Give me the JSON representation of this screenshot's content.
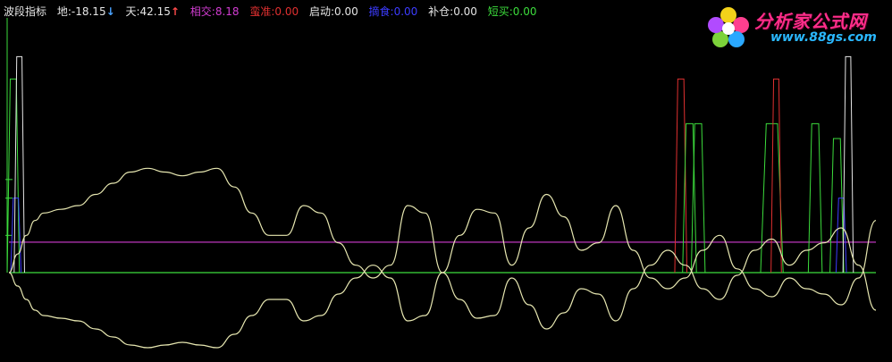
{
  "legend": {
    "indicator_name": "波段指标",
    "items": [
      {
        "label": "地:",
        "value": "-18.15",
        "color": "#e6e6e6",
        "marker": "↓"
      },
      {
        "label": "天:",
        "value": "42.15",
        "color": "#e6e6e6",
        "marker": "↑"
      },
      {
        "label": "相交:",
        "value": "8.18",
        "color": "#d23cd2"
      },
      {
        "label": "蛮准:",
        "value": "0.00",
        "color": "#e03030"
      },
      {
        "label": "启动:",
        "value": "0.00",
        "color": "#e6e6e6"
      },
      {
        "label": "摘食:",
        "value": "0.00",
        "color": "#3c3cff"
      },
      {
        "label": "补仓:",
        "value": "0.00",
        "color": "#e6e6e6"
      },
      {
        "label": "短买:",
        "value": "0.00",
        "color": "#3cdc3c"
      }
    ]
  },
  "logo": {
    "title": "分析家公式网",
    "url": "www.88gs.com"
  },
  "chart_data": {
    "type": "line",
    "ylim": [
      -30,
      60
    ],
    "xlim": [
      0,
      100
    ],
    "grid": false,
    "series": [
      {
        "color": "#e6e6b0",
        "x": [
          0,
          1,
          2,
          3,
          4,
          6,
          8,
          10,
          12,
          14,
          16,
          18,
          20,
          22,
          24,
          26,
          28,
          30,
          32,
          34,
          36,
          38,
          40,
          42,
          44,
          46,
          48,
          50,
          52,
          54,
          56,
          58,
          60,
          62,
          64,
          66,
          68,
          70,
          72,
          74,
          76,
          78,
          80,
          82,
          84,
          86,
          88,
          90,
          92,
          94,
          96,
          98,
          100
        ],
        "values": [
          0,
          5,
          10,
          14,
          16,
          17,
          18,
          21,
          24,
          27,
          28,
          27,
          26,
          27,
          28,
          23,
          16,
          10,
          10,
          18,
          16,
          8,
          2,
          -2,
          2,
          18,
          16,
          0,
          10,
          17,
          16,
          2,
          12,
          21,
          15,
          6,
          8,
          18,
          6,
          -2,
          -6,
          -2,
          6,
          10,
          1,
          -6,
          -9,
          -2,
          -6,
          -8,
          -12,
          -2,
          14
        ]
      },
      {
        "color": "#e6e6b0",
        "x": [
          0,
          1,
          2,
          3,
          4,
          6,
          8,
          10,
          12,
          14,
          16,
          18,
          20,
          22,
          24,
          26,
          28,
          30,
          32,
          34,
          36,
          38,
          40,
          42,
          44,
          46,
          48,
          50,
          52,
          54,
          56,
          58,
          60,
          62,
          64,
          66,
          68,
          70,
          72,
          74,
          76,
          78,
          80,
          82,
          84,
          86,
          88,
          90,
          92,
          94,
          96,
          98,
          100
        ],
        "values": [
          0,
          -5,
          -10,
          -14,
          -16,
          -17,
          -18,
          -21,
          -24,
          -27,
          -28,
          -27,
          -26,
          -27,
          -28,
          -23,
          -16,
          -10,
          -10,
          -18,
          -16,
          -8,
          -2,
          2,
          -2,
          -18,
          -16,
          0,
          -10,
          -17,
          -16,
          -2,
          -12,
          -21,
          -15,
          -6,
          -8,
          -18,
          -6,
          2,
          6,
          2,
          -6,
          -10,
          -1,
          6,
          9,
          2,
          6,
          8,
          12,
          2,
          -14
        ]
      }
    ],
    "horizontal_lines": [
      {
        "value": 8.18,
        "color": "#d23cd2"
      },
      {
        "value": 0,
        "color": "#3cdc3c"
      }
    ],
    "spikes": [
      {
        "x": 77.5,
        "top": 52,
        "width": 1.4,
        "color": "#e03030"
      },
      {
        "x": 78.5,
        "top": 40,
        "width": 1.6,
        "color": "#3cdc3c"
      },
      {
        "x": 79.5,
        "top": 40,
        "width": 1.6,
        "color": "#3cdc3c"
      },
      {
        "x": 88.0,
        "top": 40,
        "width": 2.6,
        "color": "#3cdc3c"
      },
      {
        "x": 88.5,
        "top": 52,
        "width": 1.2,
        "color": "#e03030"
      },
      {
        "x": 93.0,
        "top": 40,
        "width": 1.6,
        "color": "#3cdc3c"
      },
      {
        "x": 95.5,
        "top": 36,
        "width": 1.6,
        "color": "#3cdc3c"
      },
      {
        "x": 96.0,
        "top": 20,
        "width": 1.2,
        "color": "#3c3cff"
      },
      {
        "x": 96.8,
        "top": 58,
        "width": 1.2,
        "color": "#e6e6e6"
      },
      {
        "x": 0.5,
        "top": 52,
        "width": 1.4,
        "color": "#3cdc3c"
      },
      {
        "x": 0.8,
        "top": 20,
        "width": 1.2,
        "color": "#3c3cff"
      },
      {
        "x": 1.2,
        "top": 58,
        "width": 1.2,
        "color": "#e6e6e6"
      }
    ]
  }
}
